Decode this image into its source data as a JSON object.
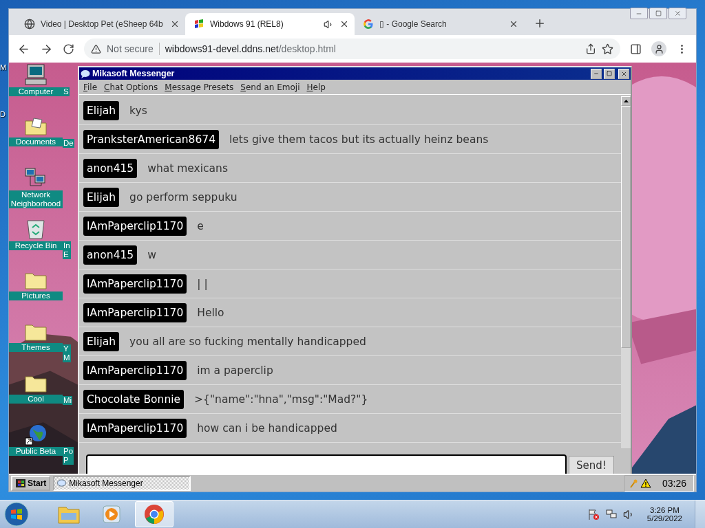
{
  "desktop_edge_labels": [
    "M",
    "D"
  ],
  "browser": {
    "tabs": [
      {
        "title": "Video | Desktop Pet (eSheep 64b",
        "selected": false,
        "kind": "globe",
        "audio": false
      },
      {
        "title": "Wibdows 91 (REL8)",
        "selected": true,
        "kind": "wibdows",
        "audio": true
      },
      {
        "title": "▯ - Google Search",
        "selected": false,
        "kind": "google",
        "audio": false
      }
    ],
    "security": "Not secure",
    "url_host": "wibdows91-devel.ddns.net",
    "url_path": "/desktop.html"
  },
  "wibdows": {
    "icons": [
      {
        "label": "Computer",
        "kind": "computer",
        "column_2": [
          "S"
        ]
      },
      {
        "label": "Documents",
        "kind": "documents",
        "column_2": [
          "De"
        ]
      },
      {
        "label": "Network Neighborhood",
        "kind": "network"
      },
      {
        "label": "Recycle Bin",
        "kind": "recycle",
        "column_2": [
          "In",
          "E"
        ]
      },
      {
        "label": "Pictures",
        "kind": "folder"
      },
      {
        "label": "Themes",
        "kind": "folder",
        "column_2": [
          "Y",
          "M"
        ]
      },
      {
        "label": "Cool",
        "kind": "folder",
        "column_2": [
          "Mi"
        ]
      },
      {
        "label": "Public Beta",
        "kind": "shortcut",
        "column_2": [
          "Po",
          "P"
        ]
      }
    ],
    "messenger": {
      "title": "Mikasoft Messenger",
      "menu": [
        "File",
        "Chat Options",
        "Message Presets",
        "Send an Emoji",
        "Help"
      ],
      "messages": [
        {
          "user": "Elijah",
          "text": "kys"
        },
        {
          "user": "PranksterAmerican8674",
          "text": "lets give them tacos but its actually heinz beans"
        },
        {
          "user": "anon415",
          "text": "what mexicans"
        },
        {
          "user": "Elijah",
          "text": "go perform seppuku"
        },
        {
          "user": "IAmPaperclip1170",
          "text": "e"
        },
        {
          "user": "anon415",
          "text": "w"
        },
        {
          "user": "IAmPaperclip1170",
          "text": "| |"
        },
        {
          "user": "IAmPaperclip1170",
          "text": "Hello"
        },
        {
          "user": "Elijah",
          "text": "you all are so fucking mentally handicapped"
        },
        {
          "user": "IAmPaperclip1170",
          "text": "im a paperclip"
        },
        {
          "user": "Chocolate Bonnie",
          "text": ">{\"name\":\"hna\",\"msg\":\"Mad?\"}"
        },
        {
          "user": "IAmPaperclip1170",
          "text": "how can i be handicapped"
        }
      ],
      "send_button": "Send!"
    },
    "taskbar": {
      "start": "Start",
      "tasks": [
        {
          "label": "Mikasoft Messenger",
          "selected": true
        }
      ],
      "clock": "03:26"
    }
  },
  "win7_taskbar": {
    "apps": [
      {
        "kind": "explorer",
        "selected": false
      },
      {
        "kind": "media",
        "selected": false
      },
      {
        "kind": "chrome",
        "selected": true
      }
    ],
    "time": "3:26 PM",
    "date": "5/29/2022"
  }
}
